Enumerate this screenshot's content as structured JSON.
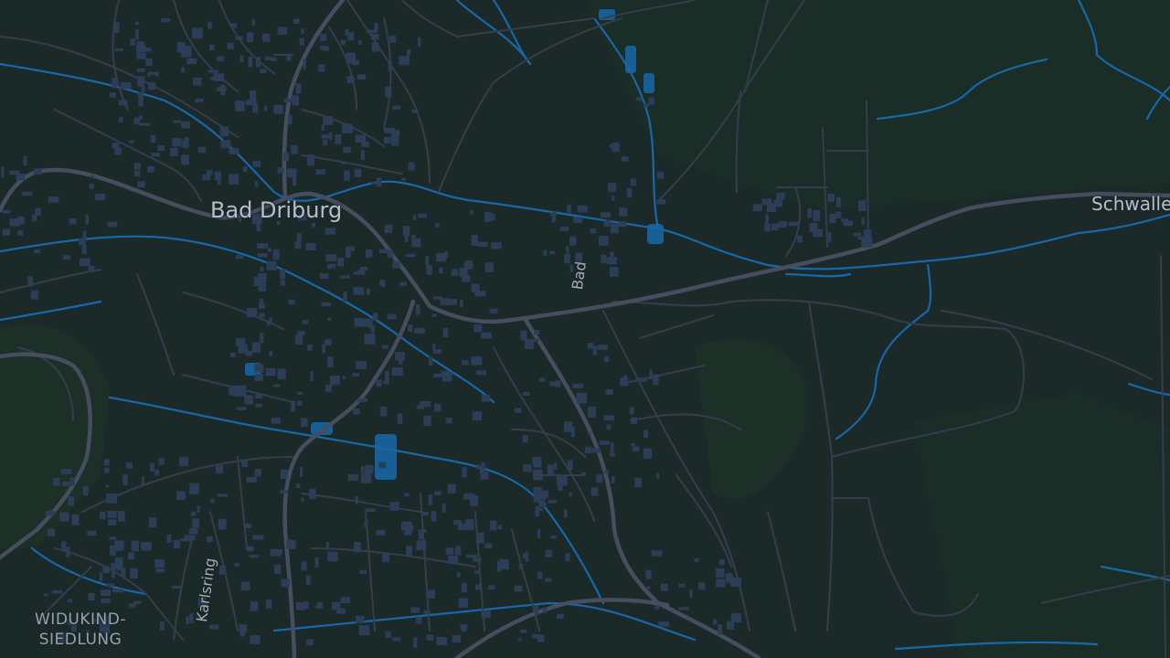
{
  "map": {
    "style": "dark",
    "colors": {
      "land": "#1b2a29",
      "forest": "#1e3127",
      "road_major": "#454d5f",
      "road_minor": "#353d4c",
      "building": "#2c3e57",
      "water": "#1768a8"
    },
    "labels": {
      "city": "Bad Driburg",
      "town_right": "Schwallenberg",
      "district": "WIDUKIND-\nSIEDLUNG",
      "street_karlsring": "Karlsring",
      "street_bad": "Bad"
    }
  }
}
